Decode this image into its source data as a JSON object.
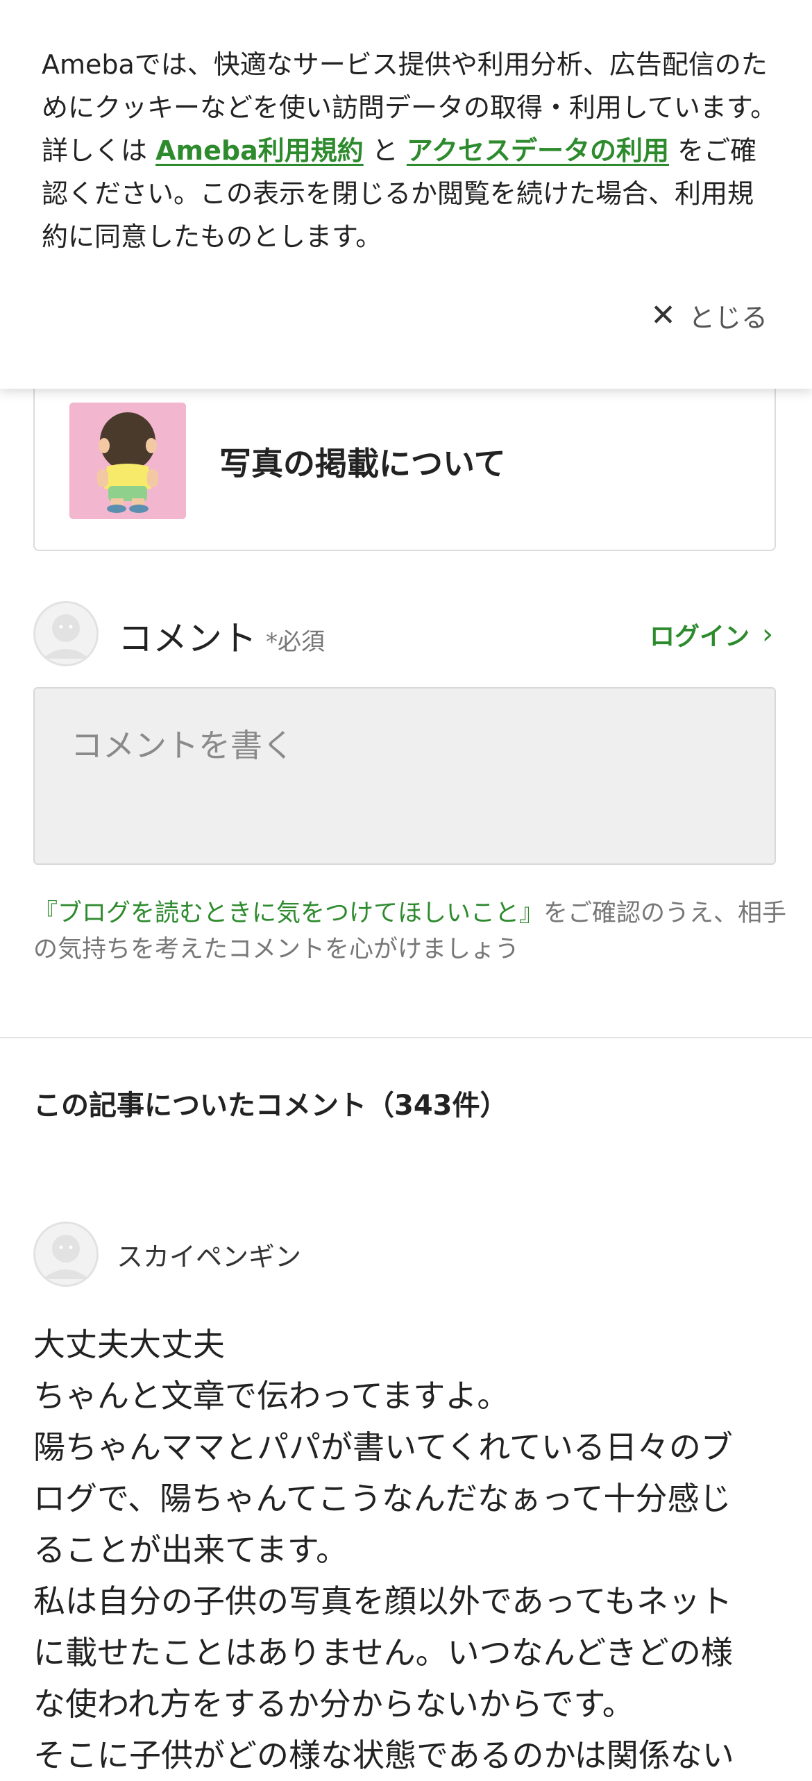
{
  "cookie_banner": {
    "text_1": "Amebaでは、快適なサービス提供や利用分析、広告配信のためにクッキーなどを使い訪問データの取得・利用しています。詳しくは ",
    "link_terms": "Ameba利用規約",
    "text_2": " と ",
    "link_access_data": "アクセスデータの利用",
    "text_3": " をご確認ください。この表示を閉じるか閲覧を続けた場合、利用規約に同意したものとします。",
    "close_label": "とじる"
  },
  "related_card": {
    "title": "写真の掲載について"
  },
  "comment_form": {
    "label": "コメント",
    "required": "*必須",
    "login_label": "ログイン",
    "placeholder": "コメントを書く",
    "notice_link": "『ブログを読むときに気をつけてほしいこと』",
    "notice_text": "をご確認のうえ、相手の気持ちを考えたコメントを心がけましょう"
  },
  "comments_section": {
    "title": "この記事についたコメント（343件）",
    "items": [
      {
        "author": "スカイペンギン",
        "lines": [
          "大丈夫大丈夫",
          "ちゃんと文章で伝わってますよ。",
          "陽ちゃんママとパパが書いてくれている日々のブ",
          "ログで、陽ちゃんてこうなんだなぁって十分感じ",
          "ることが出来てます。",
          "私は自分の子供の写真を顔以外であってもネット",
          "に載せたことはありません。いつなんどきどの様",
          "な使われ方をするか分からないからです。",
          "そこに子供がどの様な状態であるのかは関係ない"
        ]
      }
    ]
  }
}
